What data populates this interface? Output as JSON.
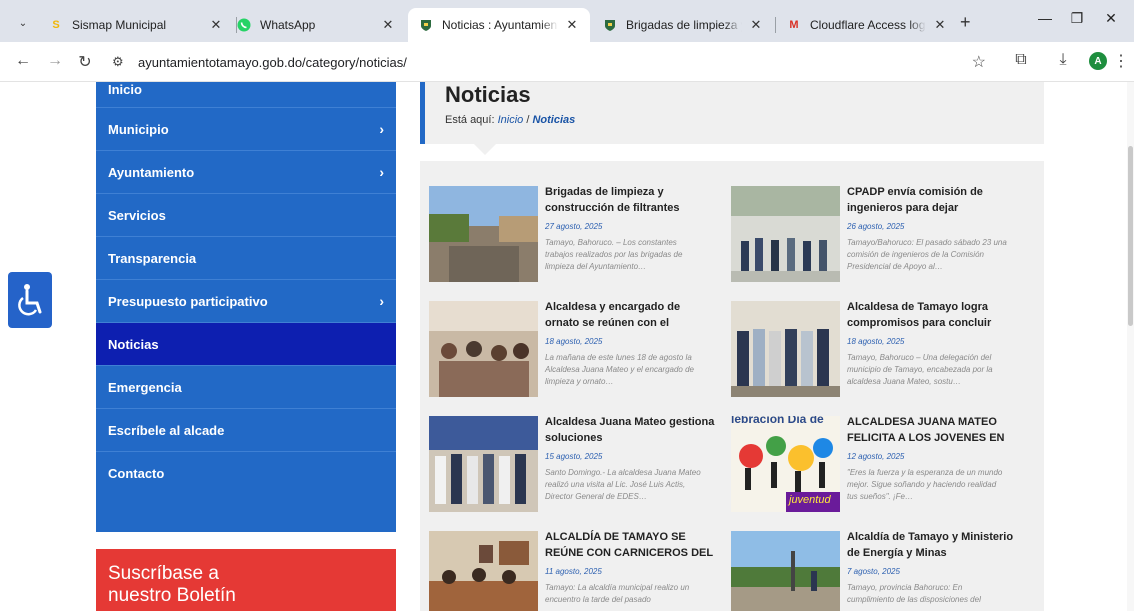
{
  "browser": {
    "tabs": [
      {
        "title": "Sismap Municipal",
        "favicon": "S",
        "favicon_color": "#f2b705"
      },
      {
        "title": "WhatsApp",
        "favicon": "whatsapp-logo",
        "favicon_color": "#25d366"
      },
      {
        "title": "Noticias : Ayuntamiento de Tamayo",
        "favicon": "crest",
        "favicon_color": "#2c6b3f"
      },
      {
        "title": "Brigadas de limpieza y construcción",
        "favicon": "crest",
        "favicon_color": "#2c6b3f"
      },
      {
        "title": "Cloudflare Access login code",
        "favicon": "M",
        "favicon_color": "#d93025"
      }
    ],
    "active_tab": 2,
    "new_tab_glyph": "+",
    "close_glyph": "✕",
    "url": "ayuntamientotamayo.gob.do/category/noticias/",
    "profile_initial": "A"
  },
  "sidebar": {
    "items": [
      {
        "label": "Inicio",
        "has_submenu": false,
        "active": false
      },
      {
        "label": "Municipio",
        "has_submenu": true,
        "active": false
      },
      {
        "label": "Ayuntamiento",
        "has_submenu": true,
        "active": false
      },
      {
        "label": "Servicios",
        "has_submenu": false,
        "active": false
      },
      {
        "label": "Transparencia",
        "has_submenu": false,
        "active": false
      },
      {
        "label": "Presupuesto participativo",
        "has_submenu": true,
        "active": false
      },
      {
        "label": "Noticias",
        "has_submenu": false,
        "active": true
      },
      {
        "label": "Emergencia",
        "has_submenu": false,
        "active": false
      },
      {
        "label": "Escríbele al alcade",
        "has_submenu": false,
        "active": false
      },
      {
        "label": "Contacto",
        "has_submenu": false,
        "active": false
      }
    ],
    "chevron": "›"
  },
  "subscribe": {
    "line1": "Suscríbase a",
    "line2": "nuestro Boletín"
  },
  "main": {
    "title": "Noticias",
    "breadcrumb_prefix": "Está aquí:",
    "breadcrumb_home": "Inicio",
    "breadcrumb_sep": "/",
    "breadcrumb_current": "Noticias"
  },
  "posts": [
    {
      "title": "Brigadas de limpieza y construcción de filtrantes",
      "date": "27 agosto, 2025",
      "excerpt": "  Tamayo, Bahoruco. – Los constantes trabajos realizados por las brigadas de limpieza del Ayuntamiento…",
      "image": "street-photo"
    },
    {
      "title": "CPADP envía comisión de ingenieros para dejar",
      "date": "26 agosto, 2025",
      "excerpt": "Tamayo/Bahoruco: El pasado sábado 23 una comisión de ingenieros de la Comisión Presidencial de Apoyo al…",
      "image": "group-photo"
    },
    {
      "title": "Alcaldesa y encargado de ornato se reúnen con el",
      "date": "18 agosto, 2025",
      "excerpt": " La mañana de este lunes 18 de agosto la Alcaldesa Juana Mateo y el encargado de limpieza y ornato…",
      "image": "meeting-photo"
    },
    {
      "title": "Alcaldesa de Tamayo logra compromisos para concluir",
      "date": "18 agosto, 2025",
      "excerpt": "Tamayo, Bahoruco – Una delegación del municipio de Tamayo, encabezada por la alcaldesa Juana Mateo, sostu…",
      "image": "group-photo"
    },
    {
      "title": "Alcaldesa Juana Mateo gestiona soluciones",
      "date": "15 agosto, 2025",
      "excerpt": "Santo Domingo.- La alcaldesa Juana Mateo realizó una visita al Lic. José Luis Actis, Director General de EDES…",
      "image": "group-photo"
    },
    {
      "title": "ALCALDESA JUANA MATEO FELICITA A LOS JOVENES EN",
      "date": "12 agosto, 2025",
      "excerpt": "\"Eres la fuerza y la esperanza de un mundo mejor. Sigue soñando y haciendo realidad tus sueños\". ¡Fe…",
      "image": "youth-poster",
      "image_text_top": "lebración Día de",
      "image_text_bottom": "juventud"
    },
    {
      "title": "ALCALDÍA DE TAMAYO SE REÚNE CON CARNICEROS DEL",
      "date": "11 agosto, 2025",
      "excerpt": "Tamayo: La alcaldía municipal realizo un encuentro la tarde del pasado",
      "image": "meeting-photo"
    },
    {
      "title": "Alcaldía de Tamayo y Ministerio de Energía y Minas",
      "date": "7 agosto, 2025",
      "excerpt": " Tamayo, provincia Bahoruco: En cumplimiento de las disposiciones del",
      "image": "street-photo"
    }
  ],
  "colors": {
    "sidebar": "#2269c6",
    "sidebar_active": "#0d1fb0",
    "subscribe": "#e53935",
    "accent_link": "#1a54a6"
  }
}
